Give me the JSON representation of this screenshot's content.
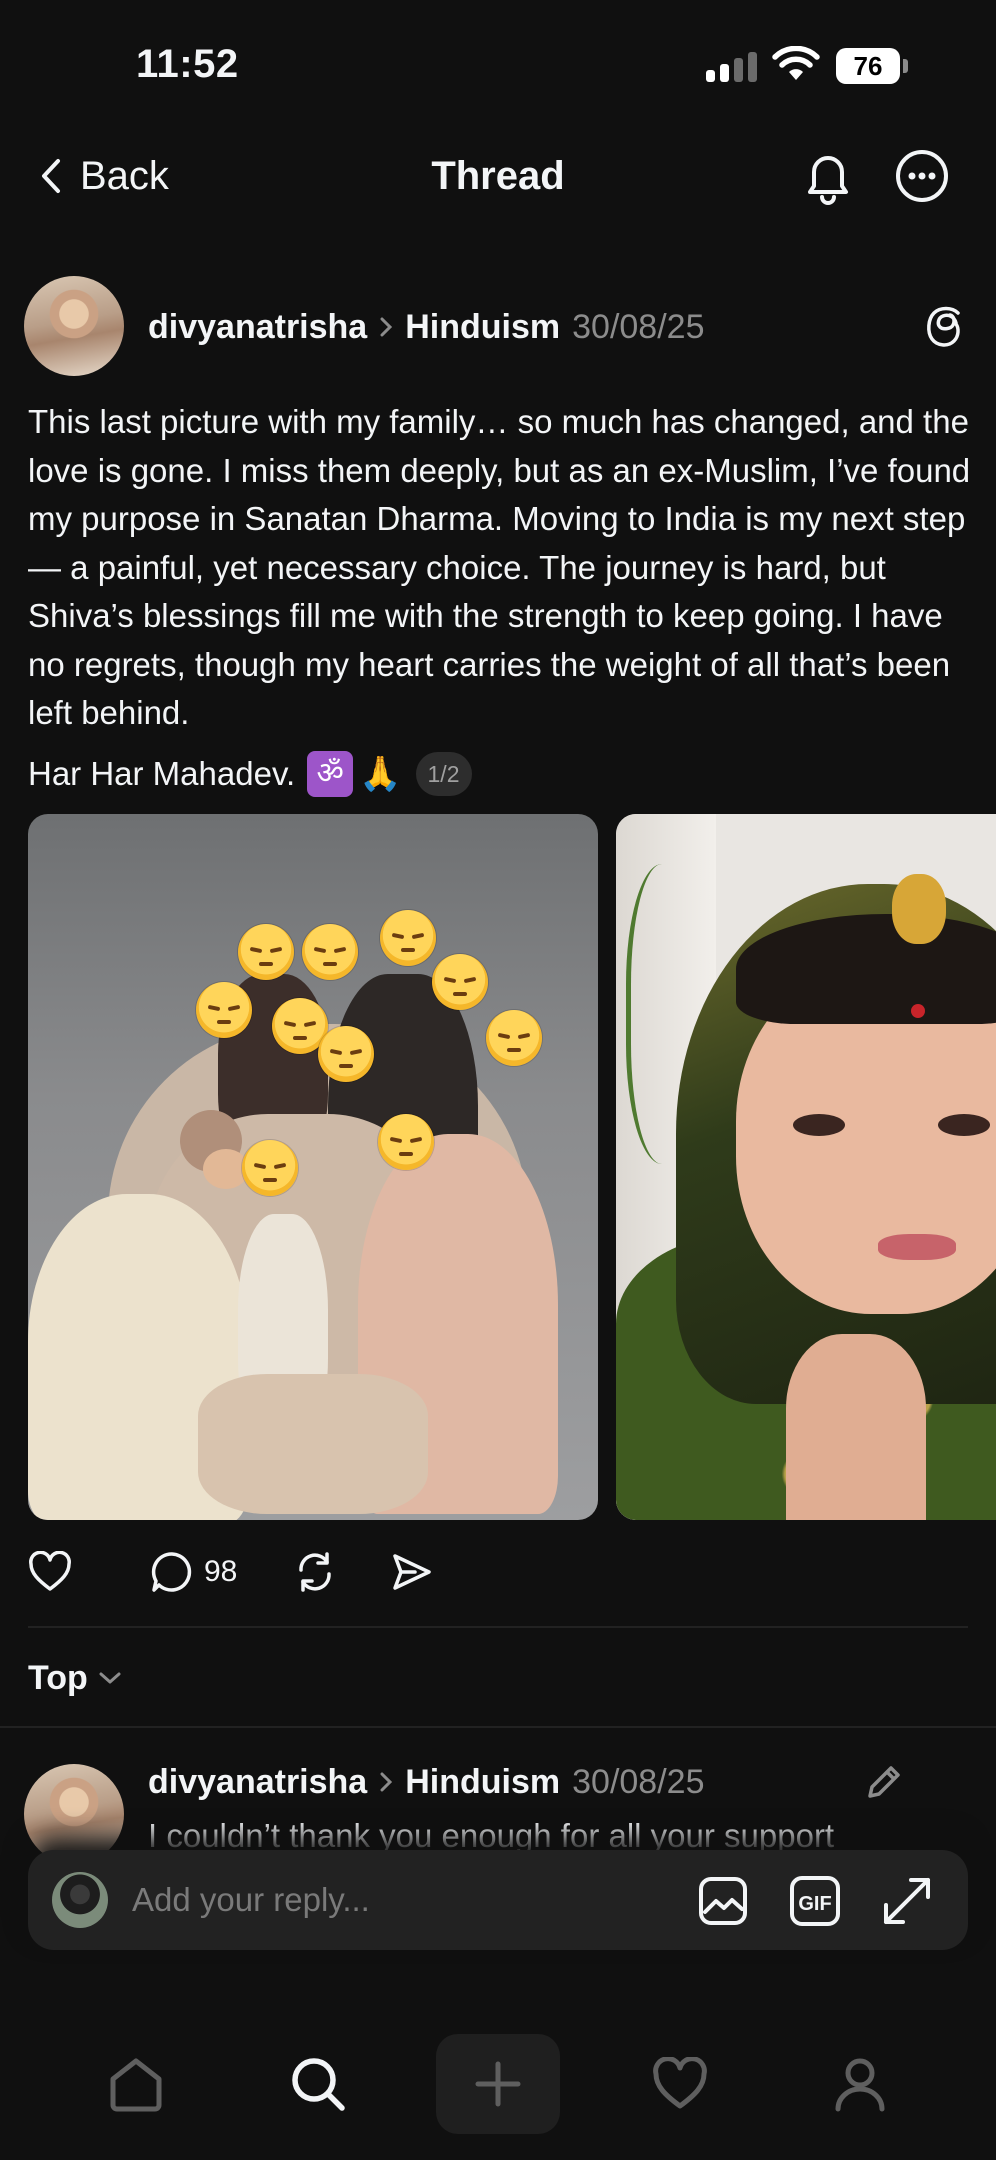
{
  "status_bar": {
    "time": "11:52",
    "battery": "76"
  },
  "header": {
    "back_label": "Back",
    "title": "Thread"
  },
  "post": {
    "username": "divyanatrisha",
    "topic": "Hinduism",
    "date": "30/08/25",
    "body": "This last picture with my family… so much has changed, and the love is gone. I miss them deeply, but as an ex-Muslim, I’ve found my purpose in Sanatan Dharma. Moving to India is my next step — a painful, yet necessary choice. The journey is hard, but Shiva’s blessings fill me with the strength to keep going. I have no regrets, though my heart carries the weight of all that’s been left behind.",
    "last_line": "Har Har Mahadev.",
    "om_emoji": "ॐ",
    "pray_emoji": "🙏",
    "media_page": "1/2",
    "comment_count": "98"
  },
  "sort": {
    "label": "Top"
  },
  "reply_preview": {
    "username": "divyanatrisha",
    "topic": "Hinduism",
    "date": "30/08/25",
    "text": "I couldn’t thank you enough for all your support"
  },
  "composer": {
    "placeholder": "Add your reply...",
    "gif_label": "GIF"
  },
  "icons": {
    "back": "chevron-left-icon",
    "notifications": "bell-icon",
    "more": "more-horizontal-icon",
    "threads": "threads-logo-icon",
    "like": "heart-icon",
    "comment": "speech-bubble-icon",
    "repost": "repost-icon",
    "share": "send-icon",
    "sort": "chevron-down-icon",
    "edit": "pencil-icon",
    "image": "image-icon",
    "gif": "gif-icon",
    "expand": "expand-icon",
    "home": "home-icon",
    "search": "search-icon",
    "create": "plus-icon",
    "activity": "heart-icon",
    "profile": "profile-icon"
  },
  "colors": {
    "background": "#101010",
    "text": "#f3f5f7",
    "muted": "#8c8c8c",
    "surface": "#222222",
    "om_emoji_bg": "#9d55c9"
  }
}
